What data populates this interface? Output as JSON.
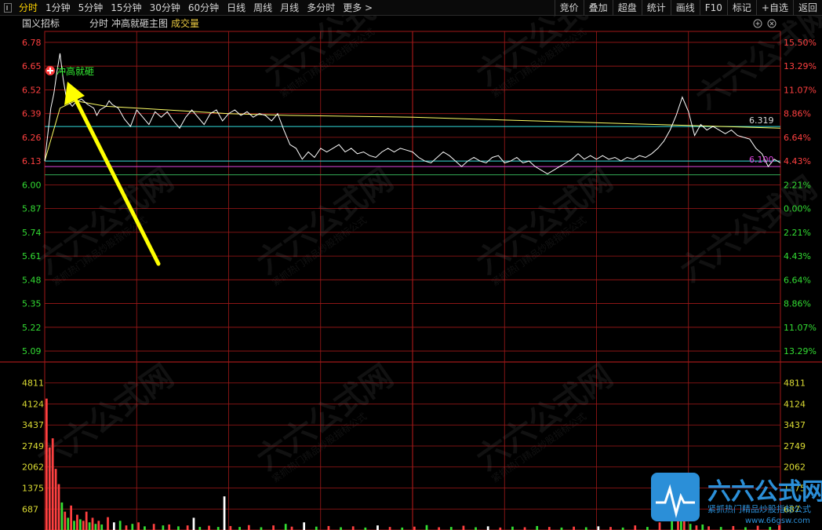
{
  "toolbar": {
    "tabs": [
      {
        "label": "分时",
        "active": true
      },
      {
        "label": "1分钟"
      },
      {
        "label": "5分钟"
      },
      {
        "label": "15分钟"
      },
      {
        "label": "30分钟"
      },
      {
        "label": "60分钟"
      },
      {
        "label": "日线"
      },
      {
        "label": "周线"
      },
      {
        "label": "月线"
      },
      {
        "label": "多分时"
      },
      {
        "label": "更多 >"
      }
    ],
    "right_buttons": [
      "竞价",
      "叠加",
      "超盘",
      "统计",
      "画线",
      "F10",
      "标记",
      "+自选",
      "返回"
    ]
  },
  "chart_header": {
    "stock_name": "国义招标",
    "mode": "分时",
    "indicator": "冲高就砸主图",
    "volume_label": "成交量"
  },
  "annotation": {
    "label": "冲高就砸",
    "arrow_color": "#ffff00"
  },
  "line_labels": {
    "upper": "6.319",
    "lower": "6.100"
  },
  "colors": {
    "background": "#000000",
    "grid": "#a01818",
    "up": "#ff4040",
    "down": "#33dd33",
    "neutral": "#ffffff",
    "price_line": "#ffffff",
    "avg_line": "#ffff66",
    "cyan_line": "#33dddd",
    "magenta_line": "#dd44dd",
    "annotation": "#33ee33",
    "label_yellow": "#ffff33"
  },
  "watermark": {
    "brand": "六六公式网",
    "slogan": "紧抓热门精品炒股指标公式",
    "site": "www.66gsw.com"
  },
  "chart_data": [
    {
      "type": "line",
      "title": "",
      "y_left_ticks": [
        "6.78",
        "6.65",
        "6.52",
        "6.39",
        "6.26",
        "6.13",
        "6.00",
        "5.87",
        "5.74",
        "5.61",
        "5.48",
        "5.35",
        "5.22",
        "5.09"
      ],
      "y_right_ticks": [
        "15.50%",
        "13.29%",
        "11.07%",
        "8.86%",
        "6.64%",
        "4.43%",
        "2.21%",
        "0.00%",
        "2.21%",
        "4.43%",
        "6.64%",
        "8.86%",
        "11.07%",
        "13.29%"
      ],
      "ylim": [
        5.03,
        6.84
      ],
      "x_range_minutes": [
        0,
        240
      ],
      "series": [],
      "price_points": [
        [
          0,
          6.13
        ],
        [
          2,
          6.42
        ],
        [
          3,
          6.5
        ],
        [
          4,
          6.62
        ],
        [
          5,
          6.72
        ],
        [
          6,
          6.58
        ],
        [
          7,
          6.48
        ],
        [
          8,
          6.45
        ],
        [
          9,
          6.43
        ],
        [
          10,
          6.45
        ],
        [
          12,
          6.47
        ],
        [
          14,
          6.44
        ],
        [
          16,
          6.42
        ],
        [
          17,
          6.38
        ],
        [
          18,
          6.41
        ],
        [
          20,
          6.43
        ],
        [
          21,
          6.46
        ],
        [
          22,
          6.44
        ],
        [
          24,
          6.42
        ],
        [
          26,
          6.36
        ],
        [
          28,
          6.32
        ],
        [
          30,
          6.41
        ],
        [
          32,
          6.37
        ],
        [
          34,
          6.33
        ],
        [
          36,
          6.4
        ],
        [
          38,
          6.37
        ],
        [
          40,
          6.4
        ],
        [
          42,
          6.35
        ],
        [
          44,
          6.31
        ],
        [
          46,
          6.37
        ],
        [
          48,
          6.41
        ],
        [
          50,
          6.37
        ],
        [
          52,
          6.33
        ],
        [
          54,
          6.39
        ],
        [
          56,
          6.41
        ],
        [
          58,
          6.35
        ],
        [
          60,
          6.39
        ],
        [
          62,
          6.41
        ],
        [
          64,
          6.38
        ],
        [
          66,
          6.4
        ],
        [
          68,
          6.37
        ],
        [
          70,
          6.39
        ],
        [
          72,
          6.38
        ],
        [
          74,
          6.35
        ],
        [
          76,
          6.39
        ],
        [
          78,
          6.3
        ],
        [
          80,
          6.22
        ],
        [
          82,
          6.2
        ],
        [
          84,
          6.14
        ],
        [
          86,
          6.18
        ],
        [
          88,
          6.15
        ],
        [
          90,
          6.2
        ],
        [
          92,
          6.18
        ],
        [
          94,
          6.2
        ],
        [
          96,
          6.22
        ],
        [
          98,
          6.18
        ],
        [
          100,
          6.2
        ],
        [
          102,
          6.17
        ],
        [
          104,
          6.18
        ],
        [
          106,
          6.16
        ],
        [
          108,
          6.15
        ],
        [
          110,
          6.18
        ],
        [
          112,
          6.2
        ],
        [
          114,
          6.18
        ],
        [
          116,
          6.2
        ],
        [
          118,
          6.19
        ],
        [
          120,
          6.18
        ],
        [
          122,
          6.15
        ],
        [
          124,
          6.13
        ],
        [
          126,
          6.12
        ],
        [
          128,
          6.15
        ],
        [
          130,
          6.18
        ],
        [
          132,
          6.16
        ],
        [
          134,
          6.13
        ],
        [
          136,
          6.1
        ],
        [
          138,
          6.13
        ],
        [
          140,
          6.15
        ],
        [
          142,
          6.13
        ],
        [
          144,
          6.12
        ],
        [
          146,
          6.15
        ],
        [
          148,
          6.16
        ],
        [
          150,
          6.12
        ],
        [
          152,
          6.13
        ],
        [
          154,
          6.15
        ],
        [
          156,
          6.12
        ],
        [
          158,
          6.13
        ],
        [
          160,
          6.1
        ],
        [
          162,
          6.08
        ],
        [
          164,
          6.06
        ],
        [
          166,
          6.08
        ],
        [
          168,
          6.1
        ],
        [
          170,
          6.12
        ],
        [
          172,
          6.14
        ],
        [
          174,
          6.17
        ],
        [
          176,
          6.14
        ],
        [
          178,
          6.16
        ],
        [
          180,
          6.14
        ],
        [
          182,
          6.16
        ],
        [
          184,
          6.14
        ],
        [
          186,
          6.15
        ],
        [
          188,
          6.13
        ],
        [
          190,
          6.15
        ],
        [
          192,
          6.14
        ],
        [
          194,
          6.16
        ],
        [
          196,
          6.15
        ],
        [
          198,
          6.17
        ],
        [
          200,
          6.2
        ],
        [
          202,
          6.24
        ],
        [
          204,
          6.3
        ],
        [
          206,
          6.38
        ],
        [
          208,
          6.48
        ],
        [
          210,
          6.4
        ],
        [
          212,
          6.27
        ],
        [
          214,
          6.33
        ],
        [
          216,
          6.3
        ],
        [
          218,
          6.32
        ],
        [
          220,
          6.3
        ],
        [
          222,
          6.28
        ],
        [
          224,
          6.3
        ],
        [
          226,
          6.27
        ],
        [
          228,
          6.26
        ],
        [
          230,
          6.25
        ],
        [
          232,
          6.2
        ],
        [
          234,
          6.17
        ],
        [
          236,
          6.1
        ],
        [
          238,
          6.14
        ],
        [
          240,
          6.12
        ]
      ],
      "avg_points": [
        [
          0,
          6.13
        ],
        [
          5,
          6.42
        ],
        [
          10,
          6.46
        ],
        [
          20,
          6.43
        ],
        [
          40,
          6.41
        ],
        [
          60,
          6.39
        ],
        [
          80,
          6.38
        ],
        [
          120,
          6.37
        ],
        [
          160,
          6.35
        ],
        [
          200,
          6.33
        ],
        [
          240,
          6.31
        ]
      ],
      "horizontal_lines": [
        {
          "value": 6.319,
          "label": "6.319",
          "color": "cyan"
        },
        {
          "value": 6.13,
          "color": "cyan"
        },
        {
          "value": 6.1,
          "label": "6.100",
          "color": "magenta"
        },
        {
          "value": 6.055,
          "color": "green"
        }
      ],
      "grid": true
    },
    {
      "type": "bar",
      "title": "成交量",
      "y_ticks": [
        "4811",
        "4124",
        "3437",
        "2749",
        "2062",
        "1375",
        "687"
      ],
      "ylim": [
        0,
        5498
      ],
      "volume_bars": [
        [
          0,
          4300,
          "up"
        ],
        [
          1,
          2700,
          "up"
        ],
        [
          2,
          3000,
          "up"
        ],
        [
          3,
          2000,
          "up"
        ],
        [
          4,
          1500,
          "up"
        ],
        [
          5,
          900,
          "down"
        ],
        [
          6,
          600,
          "up"
        ],
        [
          7,
          400,
          "down"
        ],
        [
          8,
          800,
          "up"
        ],
        [
          9,
          300,
          "down"
        ],
        [
          10,
          500,
          "up"
        ],
        [
          11,
          350,
          "down"
        ],
        [
          12,
          300,
          "up"
        ],
        [
          13,
          600,
          "up"
        ],
        [
          14,
          250,
          "down"
        ],
        [
          15,
          400,
          "up"
        ],
        [
          16,
          200,
          "down"
        ],
        [
          17,
          300,
          "up"
        ],
        [
          18,
          180,
          "down"
        ],
        [
          20,
          420,
          "up"
        ],
        [
          22,
          250,
          "neutral"
        ],
        [
          24,
          300,
          "down"
        ],
        [
          26,
          150,
          "up"
        ],
        [
          28,
          200,
          "down"
        ],
        [
          30,
          250,
          "up"
        ],
        [
          32,
          120,
          "down"
        ],
        [
          35,
          200,
          "up"
        ],
        [
          38,
          150,
          "down"
        ],
        [
          40,
          180,
          "up"
        ],
        [
          43,
          120,
          "down"
        ],
        [
          46,
          150,
          "up"
        ],
        [
          48,
          400,
          "neutral"
        ],
        [
          50,
          100,
          "down"
        ],
        [
          53,
          140,
          "up"
        ],
        [
          56,
          100,
          "down"
        ],
        [
          58,
          1100,
          "neutral"
        ],
        [
          60,
          130,
          "up"
        ],
        [
          63,
          100,
          "down"
        ],
        [
          66,
          160,
          "up"
        ],
        [
          70,
          90,
          "down"
        ],
        [
          74,
          150,
          "up"
        ],
        [
          78,
          200,
          "down"
        ],
        [
          80,
          110,
          "up"
        ],
        [
          84,
          250,
          "neutral"
        ],
        [
          88,
          110,
          "down"
        ],
        [
          92,
          130,
          "up"
        ],
        [
          96,
          90,
          "down"
        ],
        [
          100,
          120,
          "up"
        ],
        [
          104,
          80,
          "down"
        ],
        [
          108,
          150,
          "neutral"
        ],
        [
          112,
          100,
          "up"
        ],
        [
          116,
          80,
          "down"
        ],
        [
          120,
          110,
          "up"
        ],
        [
          124,
          160,
          "down"
        ],
        [
          128,
          90,
          "up"
        ],
        [
          132,
          100,
          "down"
        ],
        [
          136,
          140,
          "up"
        ],
        [
          140,
          90,
          "down"
        ],
        [
          144,
          120,
          "neutral"
        ],
        [
          148,
          80,
          "up"
        ],
        [
          152,
          110,
          "down"
        ],
        [
          156,
          90,
          "up"
        ],
        [
          160,
          130,
          "down"
        ],
        [
          164,
          100,
          "up"
        ],
        [
          168,
          80,
          "down"
        ],
        [
          172,
          110,
          "up"
        ],
        [
          176,
          90,
          "down"
        ],
        [
          180,
          120,
          "neutral"
        ],
        [
          184,
          100,
          "up"
        ],
        [
          188,
          80,
          "down"
        ],
        [
          192,
          150,
          "up"
        ],
        [
          196,
          100,
          "down"
        ],
        [
          200,
          250,
          "up"
        ],
        [
          204,
          380,
          "down"
        ],
        [
          206,
          600,
          "up"
        ],
        [
          207,
          450,
          "down"
        ],
        [
          208,
          300,
          "up"
        ],
        [
          210,
          200,
          "down"
        ],
        [
          212,
          150,
          "up"
        ],
        [
          214,
          180,
          "down"
        ],
        [
          216,
          120,
          "up"
        ],
        [
          220,
          100,
          "down"
        ],
        [
          224,
          130,
          "up"
        ],
        [
          228,
          90,
          "down"
        ],
        [
          232,
          140,
          "up"
        ],
        [
          236,
          100,
          "down"
        ],
        [
          239,
          160,
          "up"
        ]
      ],
      "grid": true
    }
  ]
}
